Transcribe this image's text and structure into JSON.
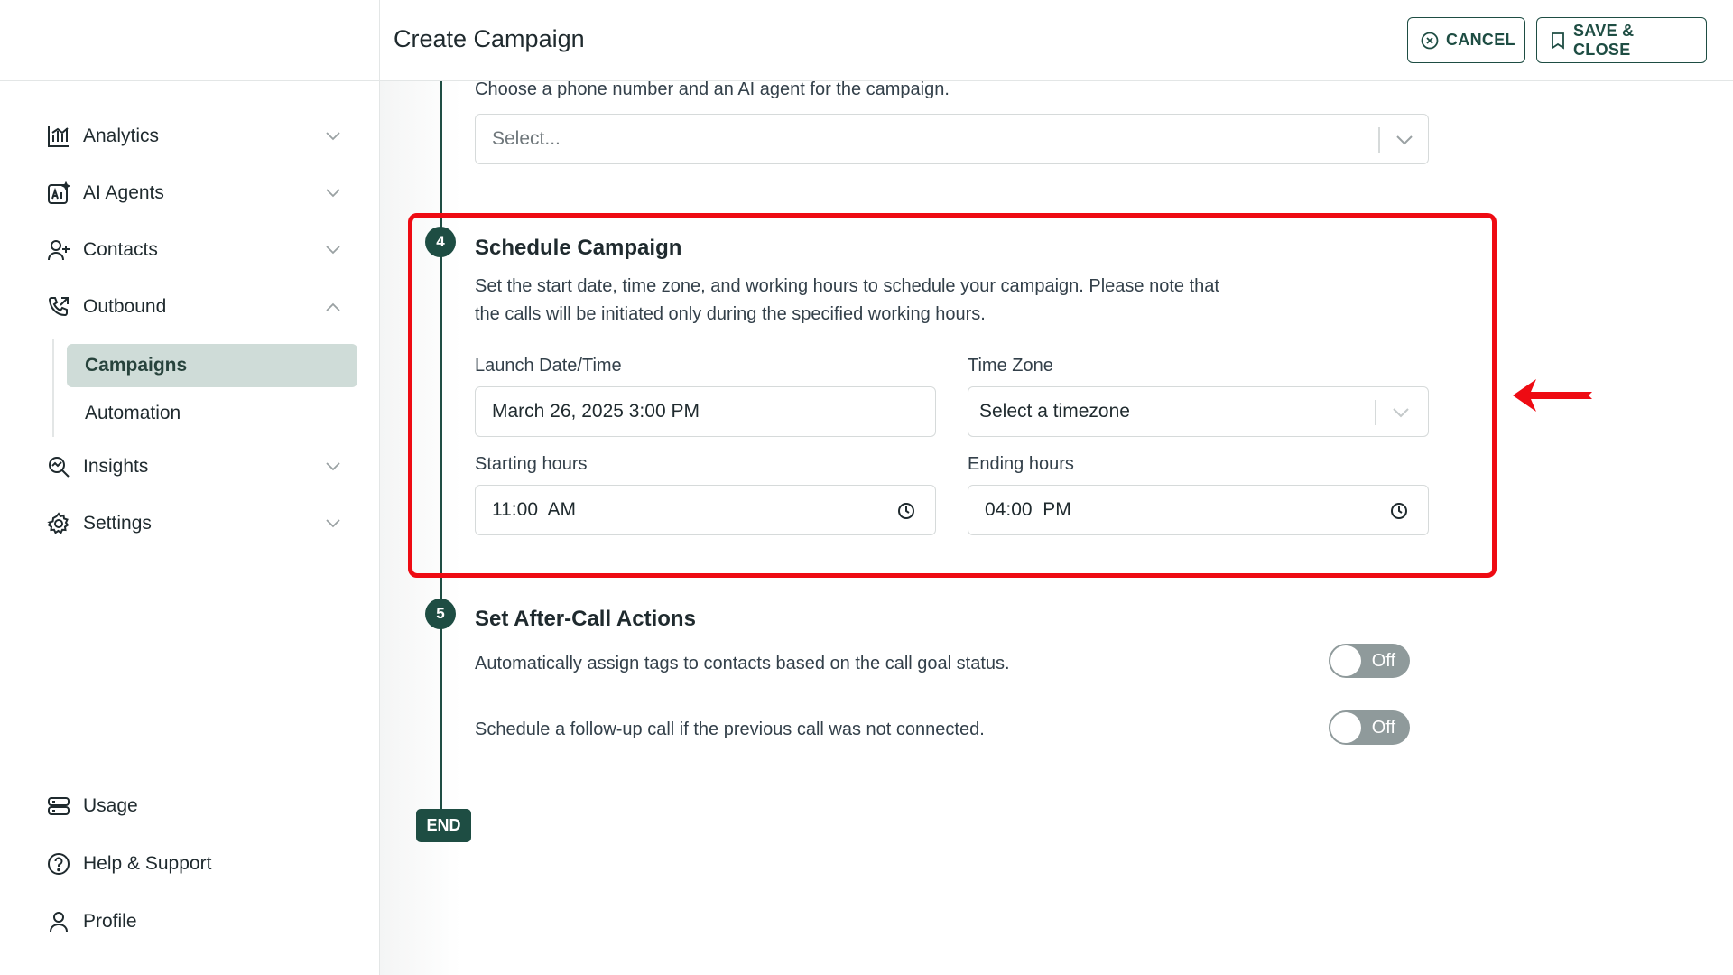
{
  "header": {
    "title": "Create Campaign",
    "cancel_label": "CANCEL",
    "save_label": "SAVE & CLOSE"
  },
  "sidebar": {
    "items": [
      {
        "label": "Analytics",
        "icon": "analytics-icon"
      },
      {
        "label": "AI Agents",
        "icon": "ai-agents-icon"
      },
      {
        "label": "Contacts",
        "icon": "contact-add-icon"
      },
      {
        "label": "Outbound",
        "icon": "phone-outbound-icon"
      },
      {
        "label": "Insights",
        "icon": "insights-icon"
      },
      {
        "label": "Settings",
        "icon": "gear-icon"
      }
    ],
    "subitems": [
      {
        "label": "Campaigns",
        "active": true
      },
      {
        "label": "Automation",
        "active": false
      }
    ],
    "bottom_items": [
      {
        "label": "Usage",
        "icon": "usage-icon"
      },
      {
        "label": "Help & Support",
        "icon": "help-icon"
      },
      {
        "label": "Profile",
        "icon": "profile-icon"
      }
    ]
  },
  "step3": {
    "description": "Choose a phone number and an AI agent for the campaign.",
    "select_placeholder": "Select..."
  },
  "step4": {
    "number": "4",
    "title": "Schedule Campaign",
    "description_line1": "Set the start date, time zone, and working hours to schedule your campaign. Please note that",
    "description_line2": "the calls will be initiated only during the specified working hours.",
    "launch_label": "Launch Date/Time",
    "launch_value": "March 26, 2025 3:00 PM",
    "timezone_label": "Time Zone",
    "timezone_value": "Select a timezone",
    "start_label": "Starting hours",
    "start_value": "11:00  AM",
    "end_label": "Ending hours",
    "end_value": "04:00  PM"
  },
  "step5": {
    "number": "5",
    "title": "Set After-Call Actions",
    "option1": "Automatically assign tags to contacts based on the call goal status.",
    "option1_state": "Off",
    "option2": "Schedule a follow-up call if the previous call was not connected.",
    "option2_state": "Off"
  },
  "end_label": "END",
  "colors": {
    "accent": "#1e4d43",
    "highlight": "#ee0b13",
    "active_nav_bg": "#cfdcd8",
    "toggle_off": "#8f9a9b"
  }
}
